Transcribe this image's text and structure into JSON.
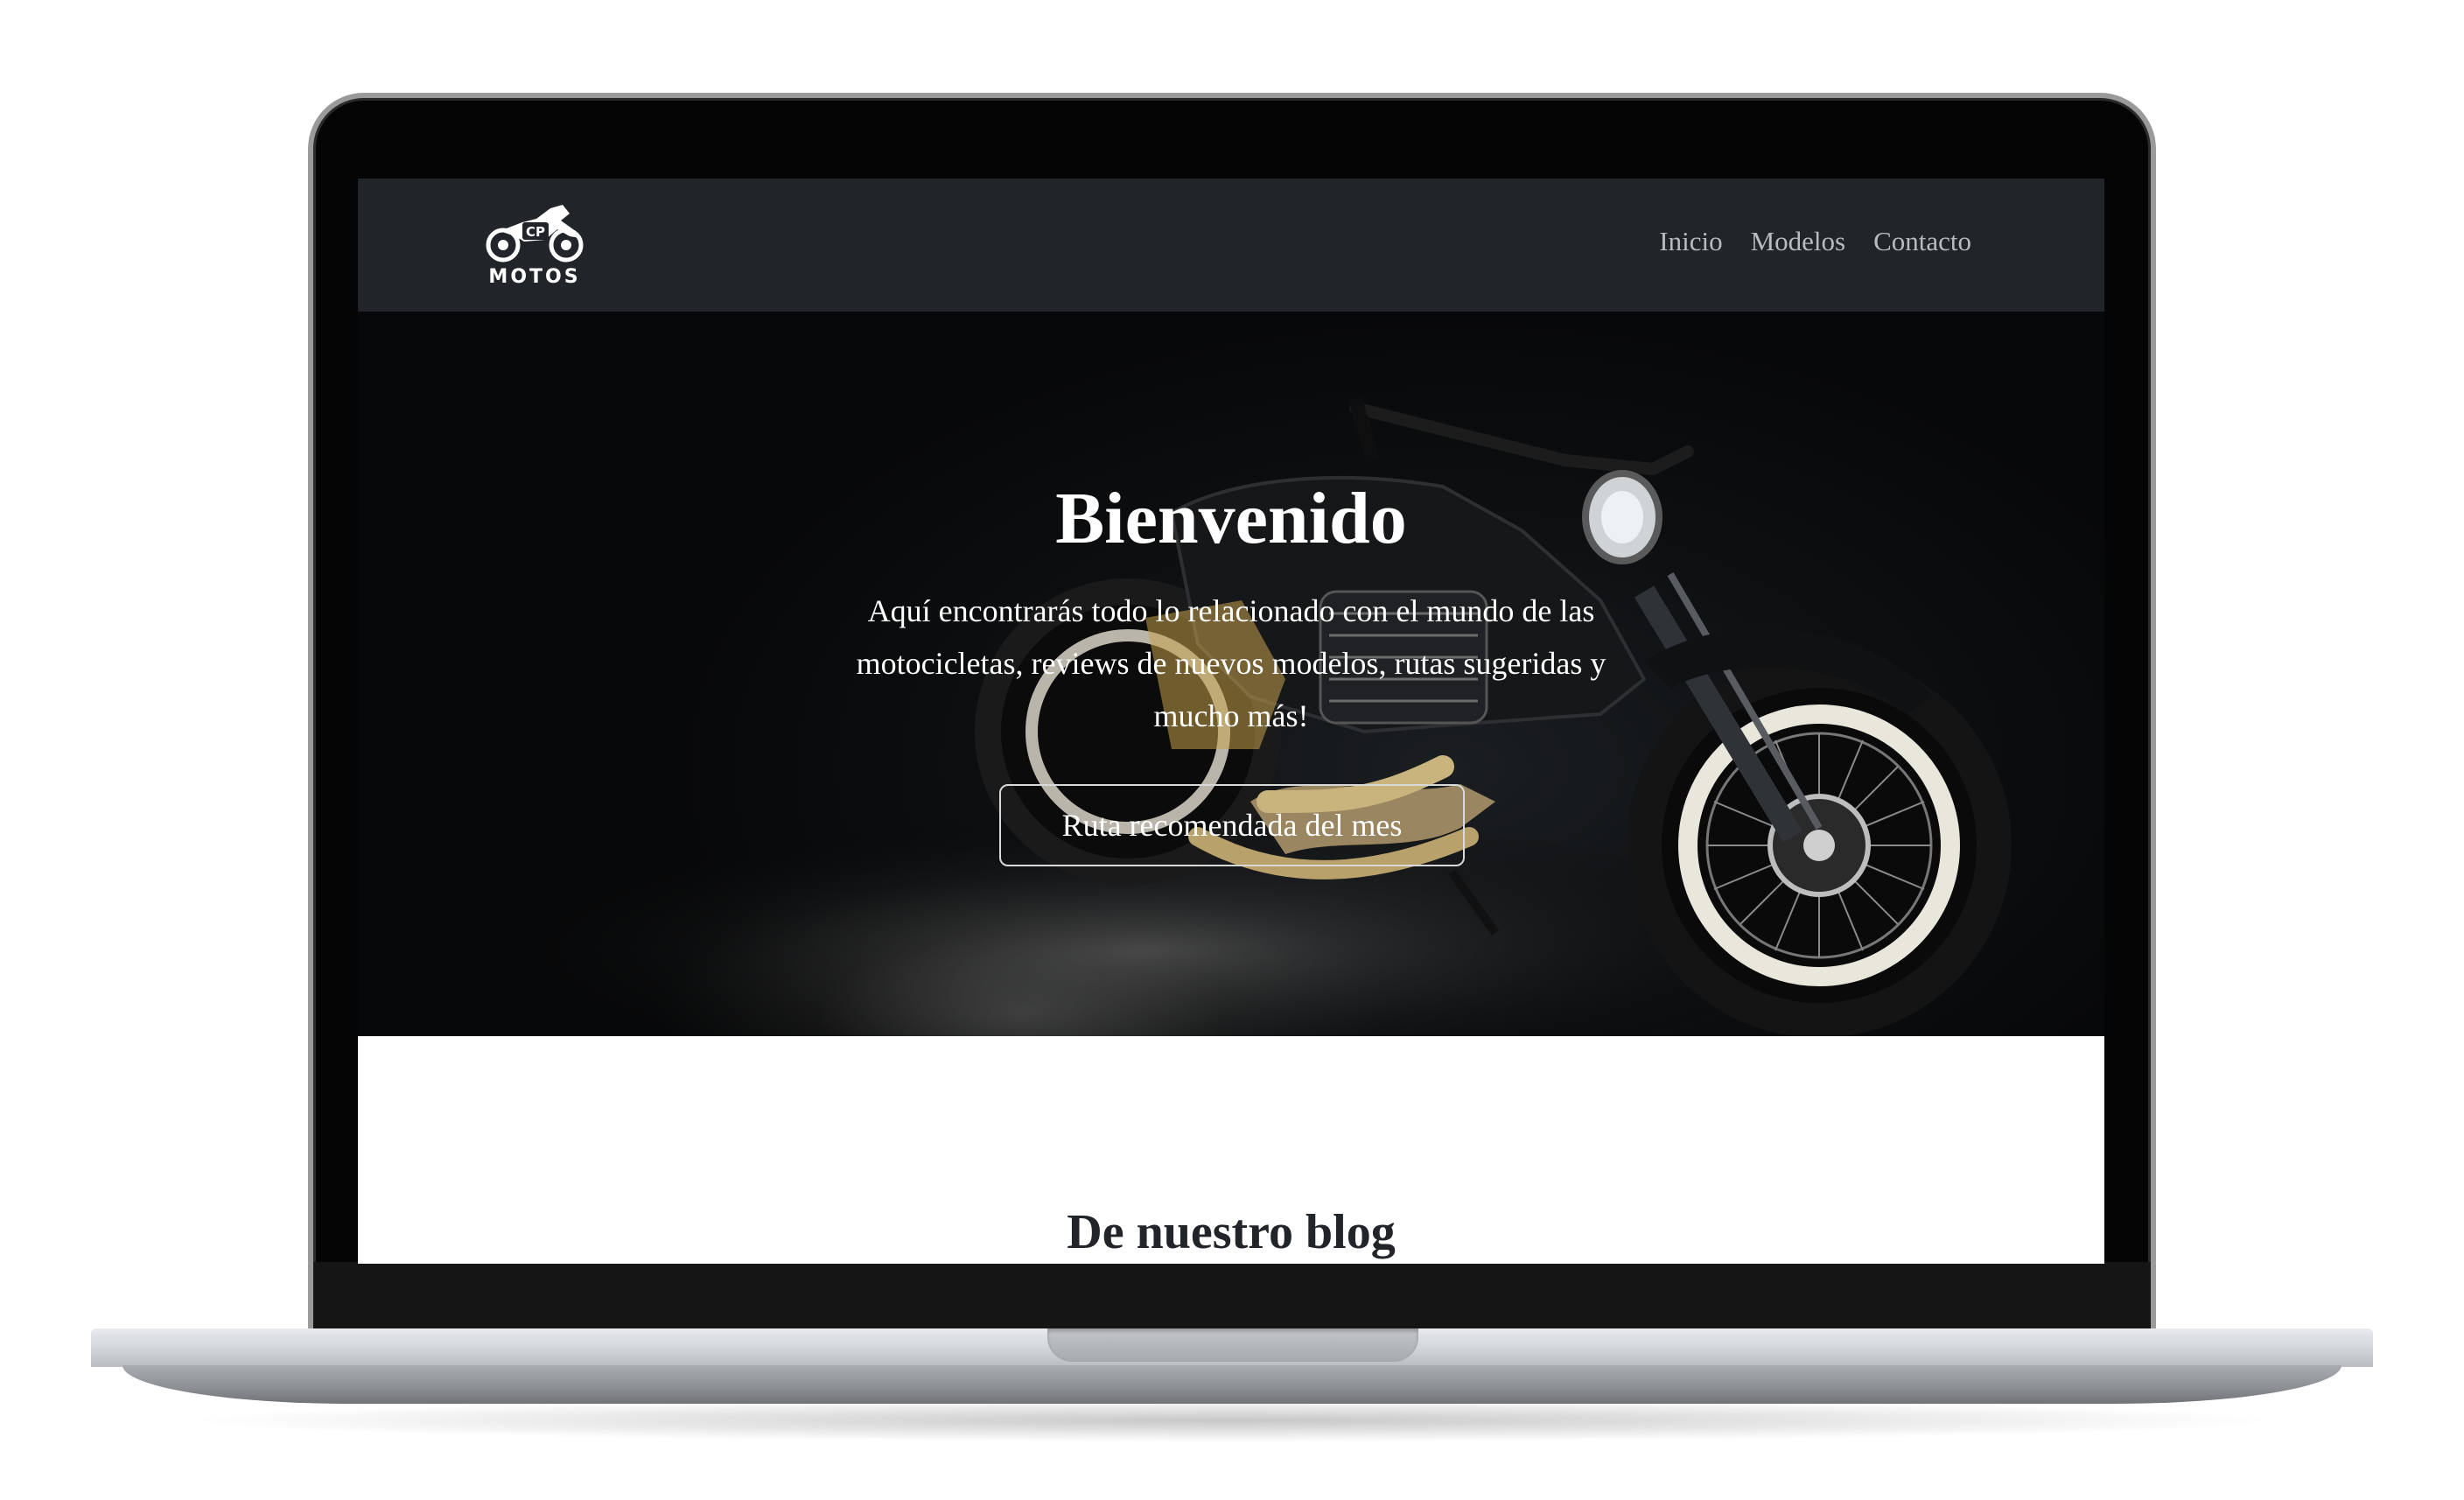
{
  "navbar": {
    "logo_text": "MOTOS",
    "logo_badge": "CP",
    "links": [
      "Inicio",
      "Modelos",
      "Contacto"
    ]
  },
  "hero": {
    "title": "Bienvenido",
    "text": "Aquí encontrarás todo lo relacionado con el mundo de las motocicletas, reviews de nuevos modelos, rutas sugeridas y mucho más!",
    "button_label": "Ruta recomendada del mes"
  },
  "blog": {
    "title": "De nuestro blog"
  },
  "colors": {
    "navbar_bg": "#212529",
    "hero_bg": "#0b0d0f",
    "nav_link": "#b9bcbf",
    "text_dark": "#212529"
  }
}
